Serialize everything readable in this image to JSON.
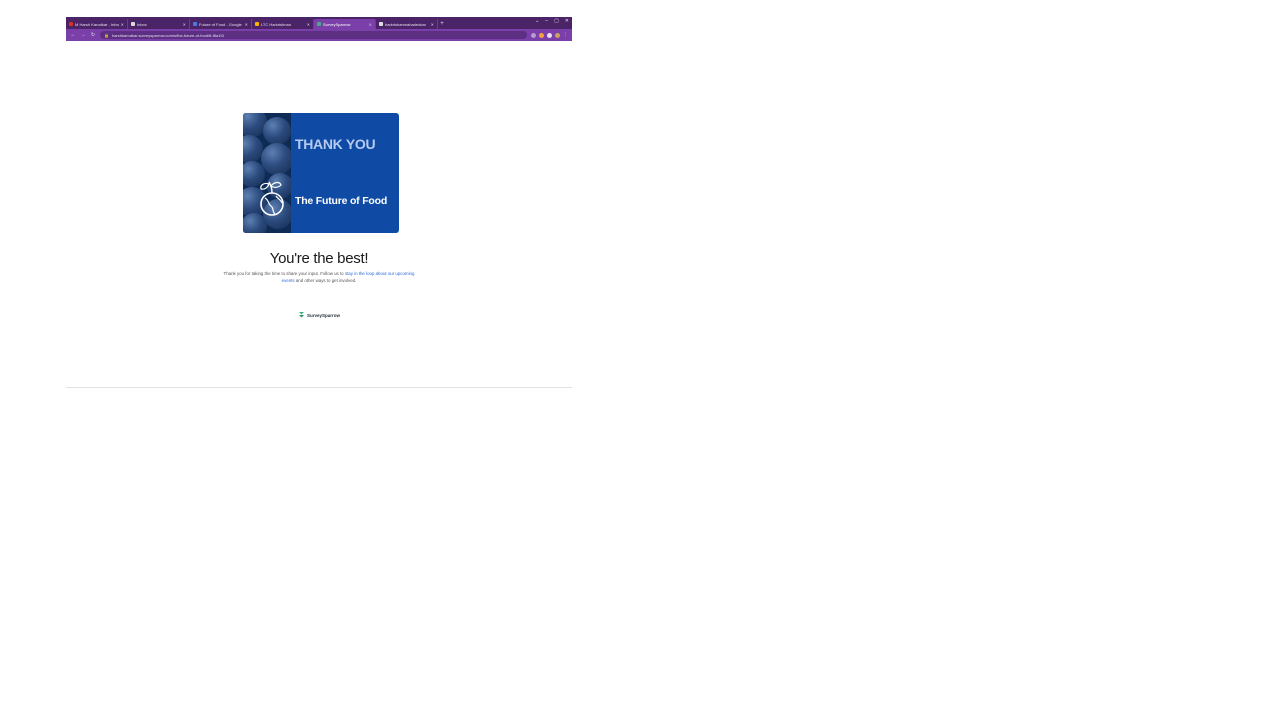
{
  "browser": {
    "tabs": [
      {
        "label": "M Harsh Karodkar - Inbox",
        "favicon_color": "#d93025",
        "active": false
      },
      {
        "label": "Inbox",
        "favicon_color": "#dcdcdc",
        "active": false
      },
      {
        "label": "Future of Food - Google Docs",
        "favicon_color": "#4a7be3",
        "active": false
      },
      {
        "label": "LTC Harkrishnan",
        "favicon_color": "#f4b400",
        "active": false
      },
      {
        "label": "SurveySparrow",
        "favicon_color": "#3fb37f",
        "active": true
      },
      {
        "label": "harkrishanmahadeokar",
        "favicon_color": "#e0e0e0",
        "active": false
      }
    ],
    "new_tab_glyph": "+",
    "window_controls": [
      "⌄",
      "–",
      "▢",
      "✕"
    ],
    "url": "harshkarodkar.surveysparrow.com/s/the-future-of-food/tt-f8a1f3"
  },
  "banner": {
    "title": "THANK YOU",
    "subtitle": "The Future of Food"
  },
  "thanks": {
    "headline": "You're the best!",
    "line1_prefix": "Thank you for taking the time to share your input. Follow us to",
    "line1_link": "stay in the loop about our upcoming",
    "line2_link": "events",
    "line2_suffix": "and other ways to get involved."
  },
  "branding": {
    "name": "SurveySparrow",
    "accent": "#3fb37f"
  },
  "colors": {
    "tabbar": "#4b2468",
    "toolbar": "#7a3fa8",
    "banner_blue": "#0f4aa5"
  }
}
